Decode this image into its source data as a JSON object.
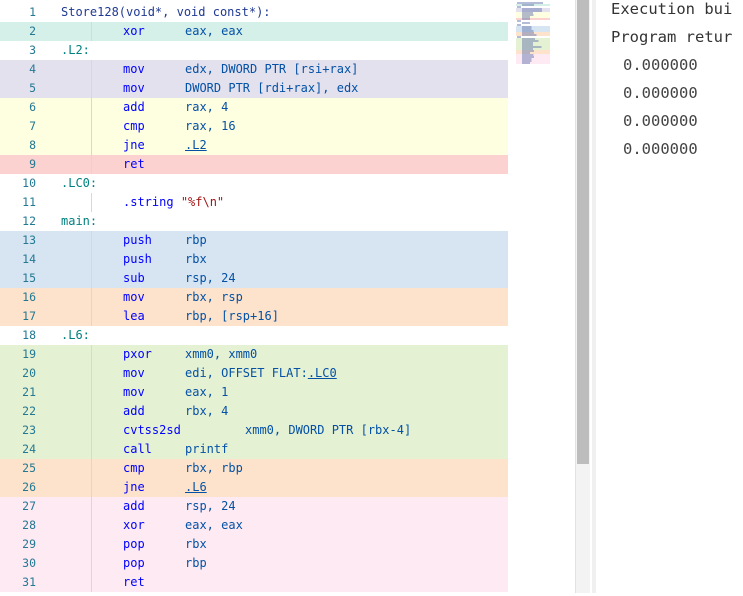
{
  "colors": {
    "teal": "#d5efe9",
    "purple": "#e4e1ef",
    "yellow": "#fefee0",
    "red": "#fcd2d0",
    "blue": "#d6e5f1",
    "orange": "#fde3cb",
    "green": "#e5f1d3",
    "pink": "#fdeaf3",
    "white": "#ffffff"
  },
  "lines": [
    {
      "n": "1",
      "bg": "white",
      "kind": "fn",
      "label": "Store128(void*, void const*):"
    },
    {
      "n": "2",
      "bg": "teal",
      "kind": "ins",
      "instr": "xor",
      "ops": "eax, eax"
    },
    {
      "n": "3",
      "bg": "white",
      "kind": "label",
      "label": ".L2:"
    },
    {
      "n": "4",
      "bg": "purple",
      "kind": "ins",
      "instr": "mov",
      "ops": "edx, DWORD PTR [rsi+rax]"
    },
    {
      "n": "5",
      "bg": "purple",
      "kind": "ins",
      "instr": "mov",
      "ops": "DWORD PTR [rdi+rax], edx"
    },
    {
      "n": "6",
      "bg": "yellow",
      "kind": "ins",
      "instr": "add",
      "ops": "rax, 4"
    },
    {
      "n": "7",
      "bg": "yellow",
      "kind": "ins",
      "instr": "cmp",
      "ops": "rax, 16"
    },
    {
      "n": "8",
      "bg": "yellow",
      "kind": "ins",
      "instr": "jne",
      "link": ".L2"
    },
    {
      "n": "9",
      "bg": "red",
      "kind": "ins",
      "instr": "ret"
    },
    {
      "n": "10",
      "bg": "white",
      "kind": "label",
      "label": ".LC0:"
    },
    {
      "n": "11",
      "bg": "white",
      "kind": "str",
      "directive": ".string",
      "strval": "\"%f\\n\""
    },
    {
      "n": "12",
      "bg": "white",
      "kind": "label",
      "label": "main:"
    },
    {
      "n": "13",
      "bg": "blue",
      "kind": "ins",
      "instr": "push",
      "ops": "rbp"
    },
    {
      "n": "14",
      "bg": "blue",
      "kind": "ins",
      "instr": "push",
      "ops": "rbx"
    },
    {
      "n": "15",
      "bg": "blue",
      "kind": "ins",
      "instr": "sub",
      "ops": "rsp, 24"
    },
    {
      "n": "16",
      "bg": "orange",
      "kind": "ins",
      "instr": "mov",
      "ops": "rbx, rsp"
    },
    {
      "n": "17",
      "bg": "orange",
      "kind": "ins",
      "instr": "lea",
      "ops": "rbp, [rsp+16]"
    },
    {
      "n": "18",
      "bg": "white",
      "kind": "label",
      "label": ".L6:"
    },
    {
      "n": "19",
      "bg": "green",
      "kind": "ins",
      "instr": "pxor",
      "ops": "xmm0, xmm0"
    },
    {
      "n": "20",
      "bg": "green",
      "kind": "ins",
      "instr": "mov",
      "ops": "edi, OFFSET FLAT:",
      "link": ".LC0"
    },
    {
      "n": "21",
      "bg": "green",
      "kind": "ins",
      "instr": "mov",
      "ops": "eax, 1"
    },
    {
      "n": "22",
      "bg": "green",
      "kind": "ins",
      "instr": "add",
      "ops": "rbx, 4"
    },
    {
      "n": "23",
      "bg": "green",
      "kind": "ins2",
      "instr": "cvtss2sd",
      "ops": "xmm0, DWORD PTR [rbx-4]"
    },
    {
      "n": "24",
      "bg": "green",
      "kind": "ins",
      "instr": "call",
      "ops": "printf"
    },
    {
      "n": "25",
      "bg": "orange",
      "kind": "ins",
      "instr": "cmp",
      "ops": "rbx, rbp"
    },
    {
      "n": "26",
      "bg": "orange",
      "kind": "ins",
      "instr": "jne",
      "link": ".L6"
    },
    {
      "n": "27",
      "bg": "pink",
      "kind": "ins",
      "instr": "add",
      "ops": "rsp, 24"
    },
    {
      "n": "28",
      "bg": "pink",
      "kind": "ins",
      "instr": "xor",
      "ops": "eax, eax"
    },
    {
      "n": "29",
      "bg": "pink",
      "kind": "ins",
      "instr": "pop",
      "ops": "rbx"
    },
    {
      "n": "30",
      "bg": "pink",
      "kind": "ins",
      "instr": "pop",
      "ops": "rbp"
    },
    {
      "n": "31",
      "bg": "pink",
      "kind": "ins",
      "instr": "ret"
    }
  ],
  "output": {
    "header1": "Execution bui",
    "header2": "Program retur",
    "values": [
      "0.000000",
      "0.000000",
      "0.000000",
      "0.000000"
    ]
  }
}
